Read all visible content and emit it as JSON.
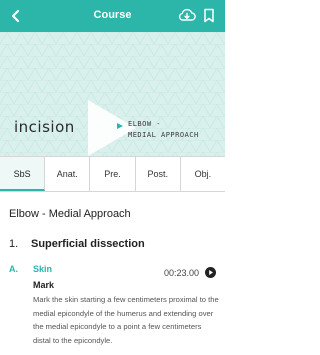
{
  "header": {
    "title": "Course",
    "back_icon": "chevron-left-icon",
    "download_icon": "cloud-download-icon",
    "bookmark_icon": "bookmark-icon",
    "color": "#2bb6a9"
  },
  "hero": {
    "logo_text": "incision",
    "procedure_line1": "ELBOW -",
    "procedure_line2": "MEDIAL APPROACH",
    "play_icon": "play-icon"
  },
  "tabs": [
    {
      "label": "SbS",
      "active": true
    },
    {
      "label": "Anat."
    },
    {
      "label": "Pre."
    },
    {
      "label": "Post."
    },
    {
      "label": "Obj."
    }
  ],
  "course_title": "Elbow - Medial Approach",
  "section": {
    "number": "1.",
    "title": "Superficial dissection"
  },
  "step": {
    "letter": "A.",
    "label": "Skin",
    "time": "00:23.00",
    "substep": "Mark",
    "description": "Mark the skin starting a few centimeters proximal to the medial epicondyle of the humerus and extending over the medial epicondyle to a point a few centimeters distal to the epicondyle."
  }
}
